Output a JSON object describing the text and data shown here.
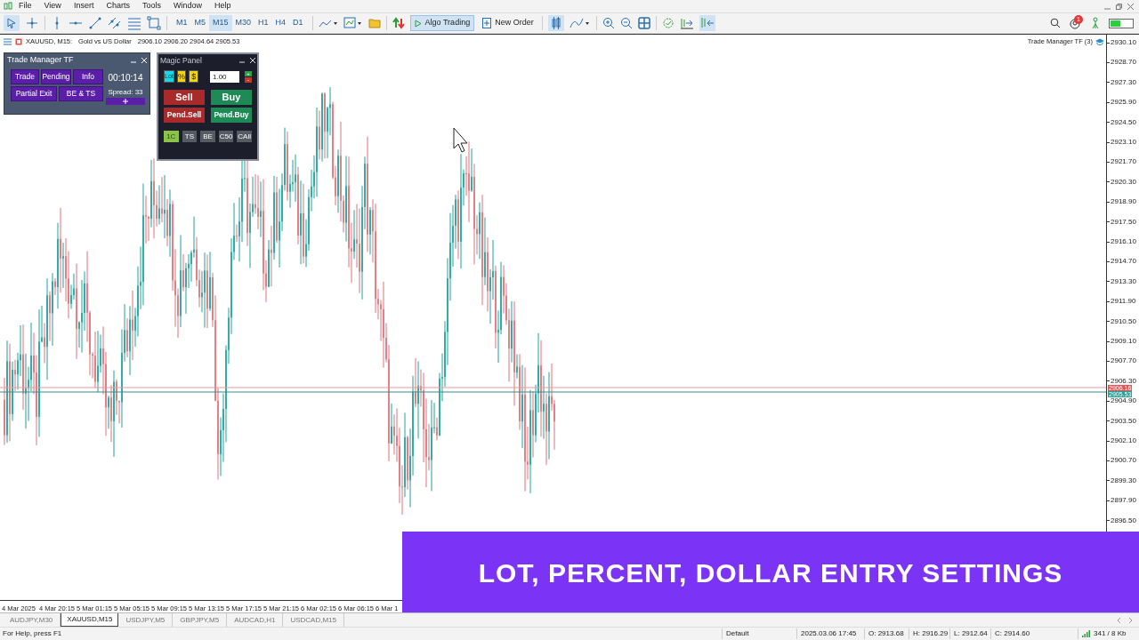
{
  "menu": [
    "File",
    "View",
    "Insert",
    "Charts",
    "Tools",
    "Window",
    "Help"
  ],
  "toolbar": {
    "timeframes": [
      {
        "label": "M1",
        "selected": false
      },
      {
        "label": "M5",
        "selected": false
      },
      {
        "label": "M15",
        "selected": true
      },
      {
        "label": "M30",
        "selected": false
      },
      {
        "label": "H1",
        "selected": false
      },
      {
        "label": "H4",
        "selected": false
      },
      {
        "label": "D1",
        "selected": false
      }
    ],
    "algo_trading": {
      "label": "Algo Trading",
      "on": true
    },
    "new_order": "New Order",
    "notification_count": "1"
  },
  "chart": {
    "symbol": "XAUUSD, M15:",
    "description": "Gold vs US Dollar",
    "ohlc": "2906.10 2906.20 2904.64 2905.53",
    "indicator_label": "Trade Manager TF (3)",
    "price_ticks": [
      "2930.10",
      "2928.70",
      "2927.30",
      "2925.90",
      "2924.50",
      "2923.10",
      "2921.70",
      "2920.30",
      "2918.90",
      "2917.50",
      "2916.10",
      "2914.70",
      "2913.30",
      "2911.90",
      "2910.50",
      "2909.10",
      "2907.70",
      "2906.30",
      "2904.90",
      "2903.50",
      "2902.10",
      "2900.70",
      "2899.30",
      "2897.90",
      "2896.50"
    ],
    "ask_label": "2906.16",
    "bid_label": "2905.53",
    "time_ticks": [
      "4 Mar 2025",
      "4 Mar 20:15",
      "5 Mar 01:15",
      "5 Mar 05:15",
      "5 Mar 09:15",
      "5 Mar 13:15",
      "5 Mar 17:15",
      "5 Mar 21:15",
      "6 Mar 02:15",
      "6 Mar 06:15",
      "6 Mar 1"
    ]
  },
  "trade_manager": {
    "title": "Trade Manager TF",
    "buttons": [
      "Trade",
      "Pending",
      "Info",
      "Partial Exit",
      "BE & TS"
    ],
    "timer": "00:10:14",
    "spread": "Spread: 33"
  },
  "magic_panel": {
    "title": "Magic Panel",
    "modes": [
      {
        "label": "Lot",
        "selected": true
      },
      {
        "label": "%",
        "selected": false
      },
      {
        "label": "$",
        "selected": false
      }
    ],
    "lot_value": "1.00",
    "plus": "+",
    "minus": "-",
    "sell": "Sell",
    "buy": "Buy",
    "pend_sell": "Pend.Sell",
    "pend_buy": "Pend.Buy",
    "actions": [
      {
        "label": "1C",
        "selected": true
      },
      {
        "label": "TS",
        "selected": false
      },
      {
        "label": "BE",
        "selected": false
      },
      {
        "label": "C50",
        "selected": false
      },
      {
        "label": "CAll",
        "selected": false
      }
    ]
  },
  "caption": "LOT, PERCENT, DOLLAR ENTRY SETTINGS",
  "tabs": [
    {
      "label": "AUDJPY,M30",
      "selected": false
    },
    {
      "label": "XAUUSD,M15",
      "selected": true
    },
    {
      "label": "USDJPY,M5",
      "selected": false
    },
    {
      "label": "GBPJPY,M5",
      "selected": false
    },
    {
      "label": "AUDCAD,H1",
      "selected": false
    },
    {
      "label": "USDCAD,M15",
      "selected": false
    }
  ],
  "status_bar": {
    "help": "For Help, press F1",
    "profile": "Default",
    "time": "2025.03.06 17:45",
    "open": "O: 2913.68",
    "high": "H: 2916.29",
    "low": "L: 2912.64",
    "close": "C: 2914.60",
    "traffic": "341 / 8 Kb"
  }
}
